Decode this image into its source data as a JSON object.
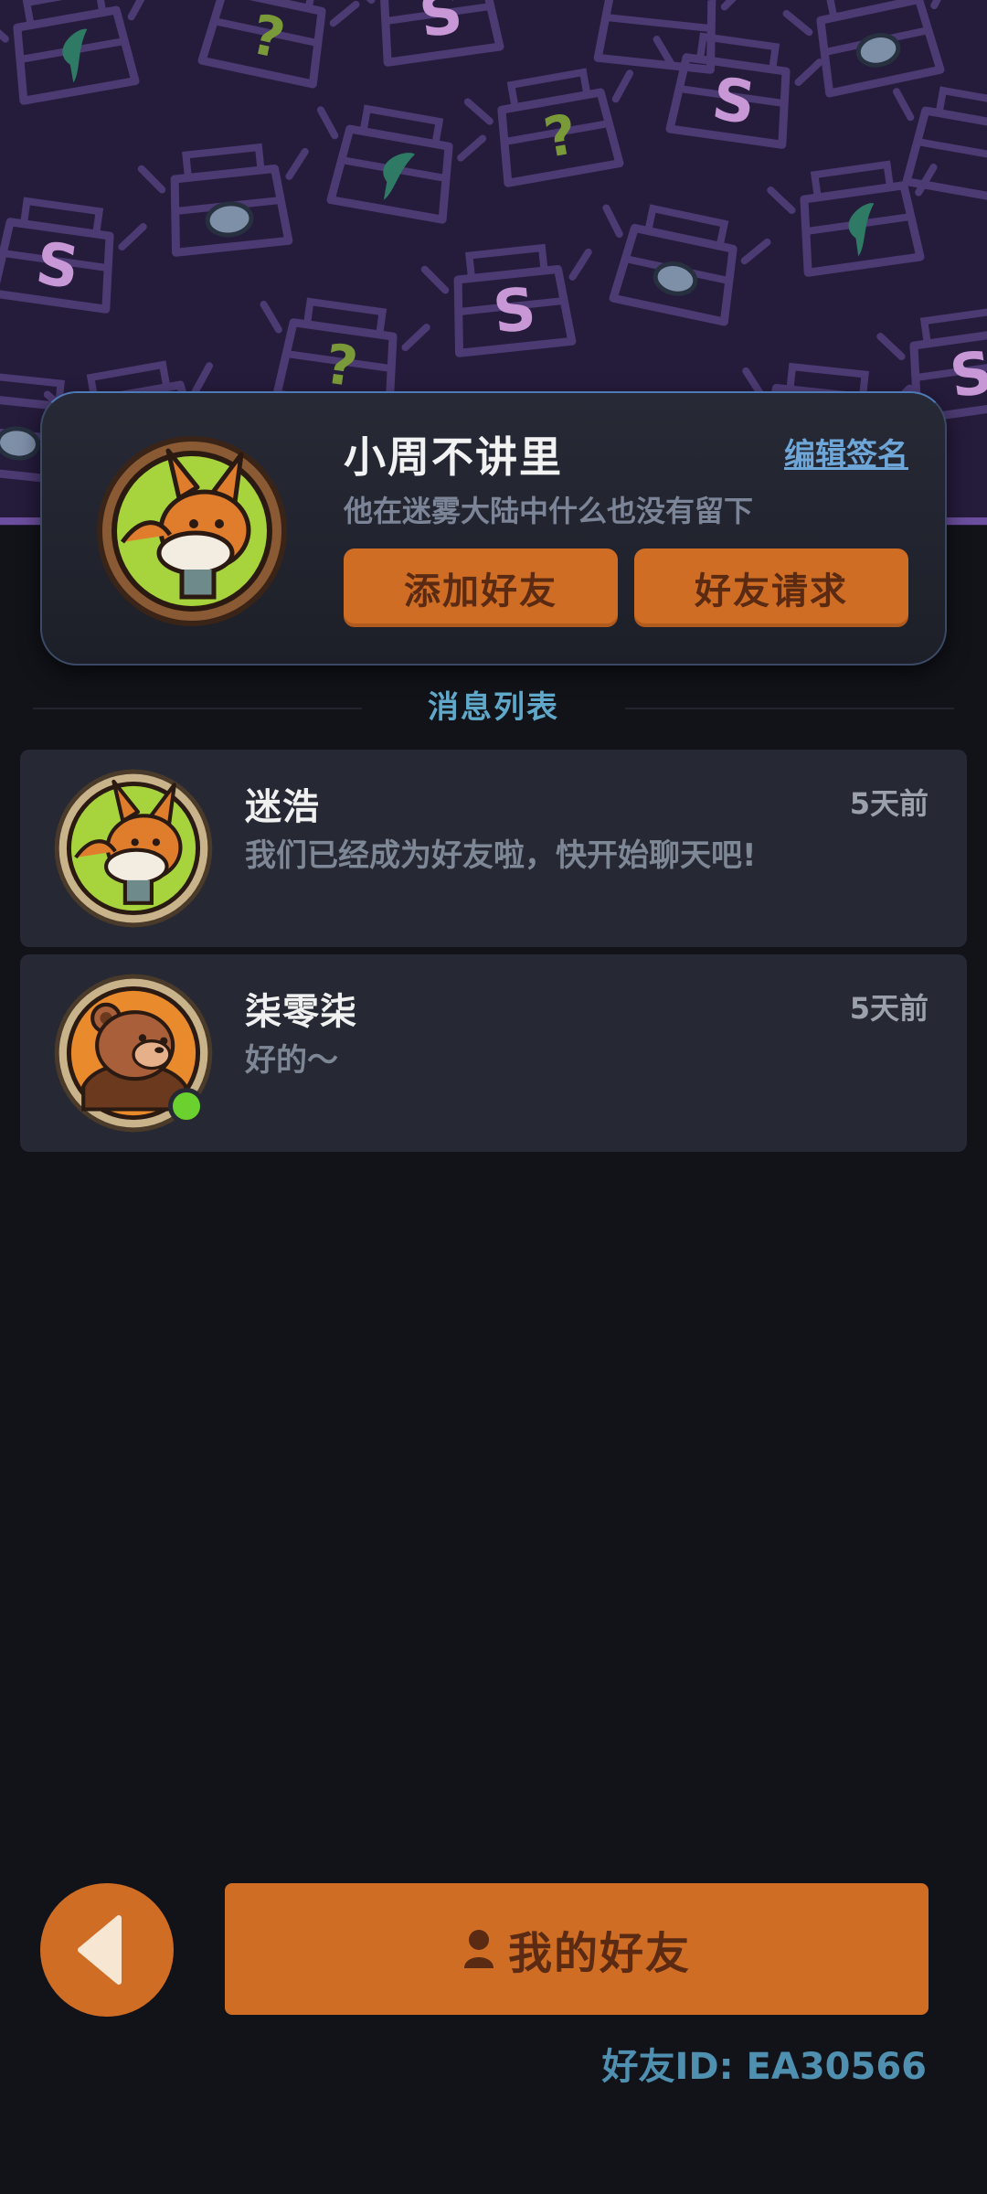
{
  "profile": {
    "name": "小周不讲里",
    "signature": "他在迷雾大陆中什么也没有留下",
    "edit_sign_label": "编辑签名",
    "add_friend_label": "添加好友",
    "friend_request_label": "好友请求"
  },
  "section": {
    "title": "消息列表"
  },
  "messages": [
    {
      "name": "迷浩",
      "time": "5天前",
      "text": "我们已经成为好友啦，快开始聊天吧!",
      "avatar": "fox-avatar",
      "online": false
    },
    {
      "name": "柒零柒",
      "time": "5天前",
      "text": "好的～",
      "avatar": "bear-avatar",
      "online": true
    }
  ],
  "bottom": {
    "my_friends_label": "我的好友",
    "friend_id": "好友ID: EA30566"
  },
  "colors": {
    "accent_orange": "#d06d24",
    "banner_purple": "#251b3b",
    "link_blue": "#6ea6d8",
    "section_title": "#5fa8c9",
    "online_green": "#6ad12f",
    "background": "#121319"
  }
}
